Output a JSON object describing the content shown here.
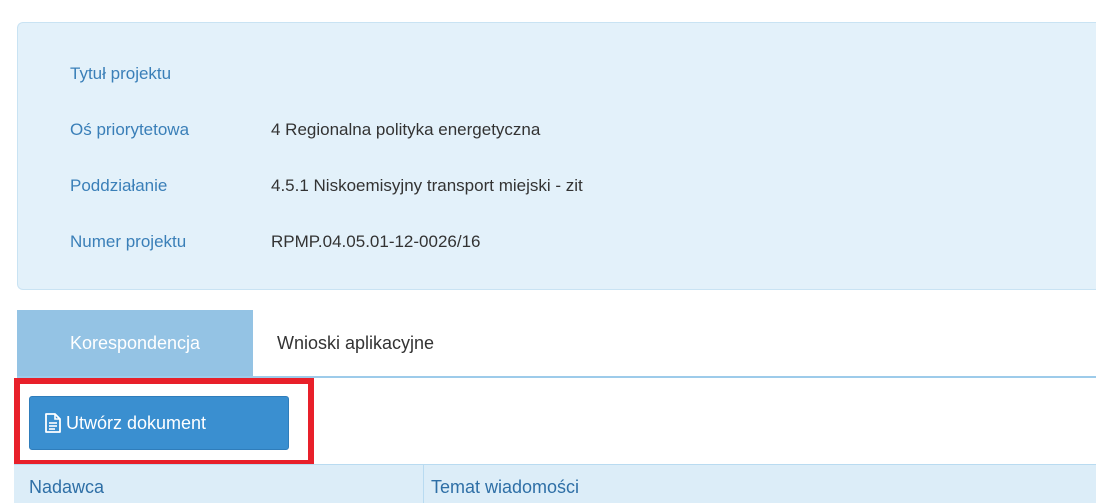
{
  "project_info": {
    "rows": [
      {
        "label": "Tytuł projektu",
        "value": ""
      },
      {
        "label": "Oś priorytetowa",
        "value": "4 Regionalna polityka energetyczna"
      },
      {
        "label": "Poddziałanie",
        "value": "4.5.1 Niskoemisyjny transport miejski - zit"
      },
      {
        "label": "Numer projektu",
        "value": "RPMP.04.05.01-12-0026/16"
      }
    ]
  },
  "tabs": [
    {
      "label": "Korespondencja",
      "active": true
    },
    {
      "label": "Wnioski aplikacyjne",
      "active": false
    }
  ],
  "toolbar": {
    "create_document_label": "Utwórz dokument",
    "create_document_icon": "document-icon"
  },
  "table": {
    "columns": [
      "Nadawca",
      "Temat wiadomości"
    ]
  },
  "colors": {
    "panel_background": "#e3f1fa",
    "label_color": "#3a7fb8",
    "active_tab": "#94c3e4",
    "button": "#3a8fd0",
    "highlight": "#e8202a"
  }
}
